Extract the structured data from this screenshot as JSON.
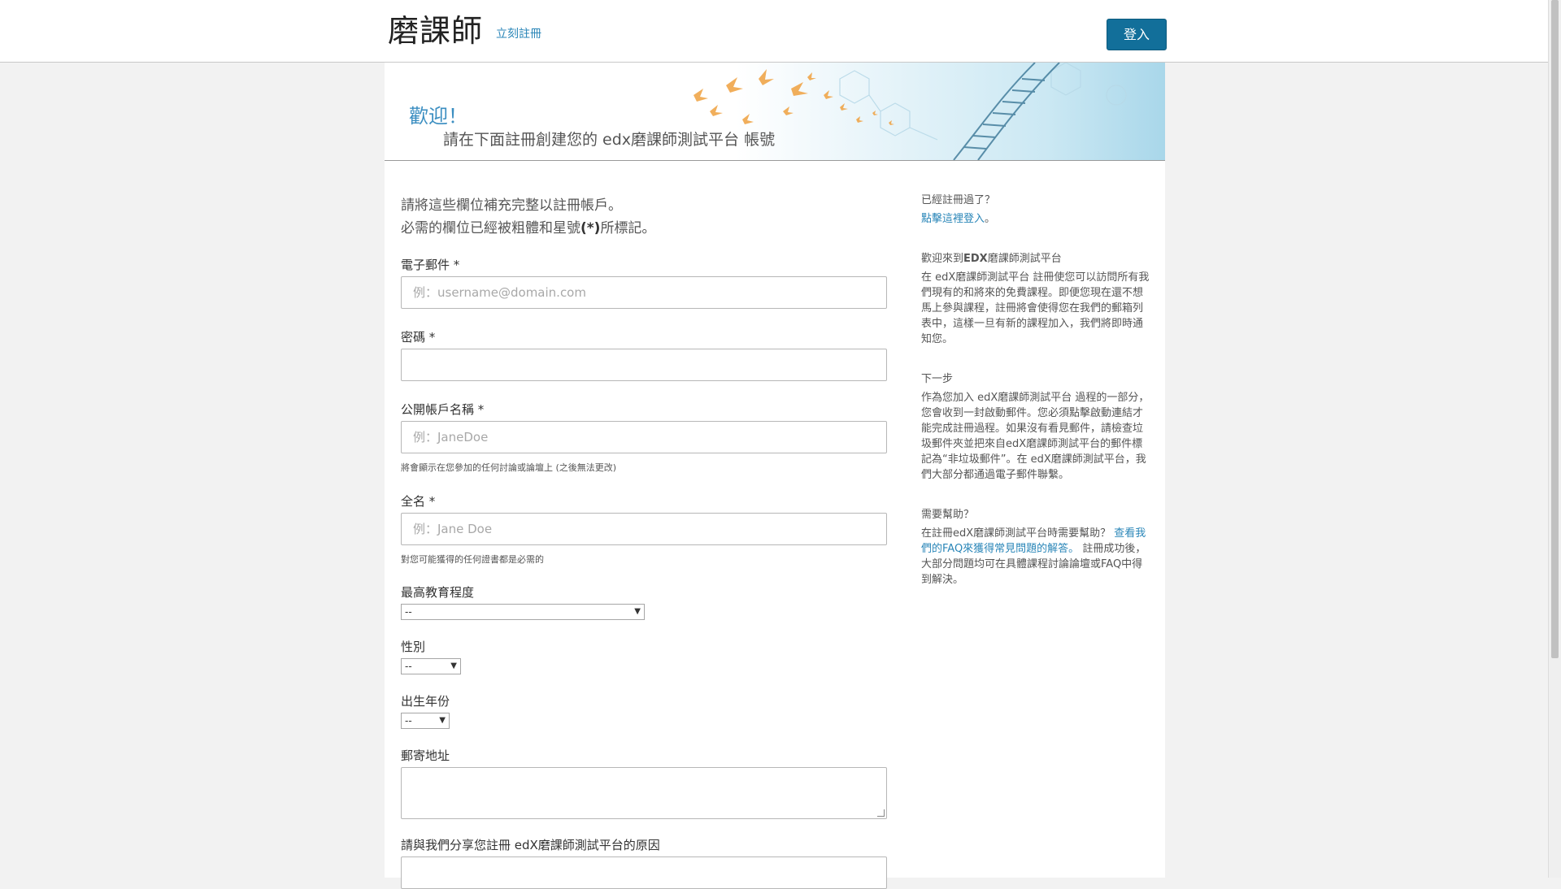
{
  "header": {
    "logo_text": "磨課師",
    "register_link": "立刻註冊",
    "login_button": "登入"
  },
  "banner": {
    "welcome": "歡迎！",
    "subtitle": "請在下面註冊創建您的 edx磨課師測試平台 帳號"
  },
  "form": {
    "intro_line1": "請將這些欄位補充完整以註冊帳戶。",
    "intro_line2_pre": "必需的欄位已經被粗體和星號",
    "intro_line2_bold": "(*)",
    "intro_line2_post": "所標記。",
    "email": {
      "label": "電子郵件 *",
      "placeholder": "例：username@domain.com",
      "value": ""
    },
    "password": {
      "label": "密碼 *",
      "placeholder": "",
      "value": ""
    },
    "username": {
      "label": "公開帳戶名稱 *",
      "placeholder": "例：JaneDoe",
      "hint": "將會顯示在您參加的任何討論或論壇上 (之後無法更改)"
    },
    "fullname": {
      "label": "全名 *",
      "placeholder": "例：Jane Doe",
      "hint": "對您可能獲得的任何證書都是必需的"
    },
    "education": {
      "label": "最高教育程度",
      "selected": "--"
    },
    "gender": {
      "label": "性別",
      "selected": "--"
    },
    "birth_year": {
      "label": "出生年份",
      "selected": "--"
    },
    "mailing_address": {
      "label": "郵寄地址"
    },
    "goals": {
      "label": "請與我們分享您註冊 edX磨課師測試平台的原因"
    },
    "select_arrow": "▼"
  },
  "sidebar": {
    "already": {
      "title": "已經註冊過了？",
      "link": "點擊這裡登入",
      "suffix": "。"
    },
    "welcome": {
      "title_pre": "歡迎來到",
      "title_bold": "EDX",
      "title_post": "磨課師測試平台",
      "body": "在 edX磨課師測試平台 註冊使您可以訪問所有我們現有的和將來的免費課程。即便您現在還不想馬上參與課程，註冊將會使得您在我們的郵箱列表中，這樣一旦有新的課程加入，我們將即時通知您。"
    },
    "next": {
      "title": "下一步",
      "body": "作為您加入 edX磨課師測試平台 過程的一部分，您會收到一封啟動郵件。您必須點擊啟動連結才能完成註冊過程。如果沒有看見郵件，請檢查垃圾郵件夾並把來自edX磨課師測試平台的郵件標記為“非垃圾郵件”。在 edX磨課師測試平台，我們大部分都通過電子郵件聯繫。"
    },
    "help": {
      "title": "需要幫助？",
      "body_pre": "在註冊edX磨課師測試平台時需要幫助？",
      "link": "查看我們的FAQ來獲得常見問題的解答。",
      "body_post": "註冊成功後，大部分問題均可在具體課程討論論壇或FAQ中得到解決。"
    }
  },
  "colors": {
    "accent_link": "#2a86b8",
    "login_button_bg": "#126f9a",
    "page_bg": "#f2f2f2"
  }
}
